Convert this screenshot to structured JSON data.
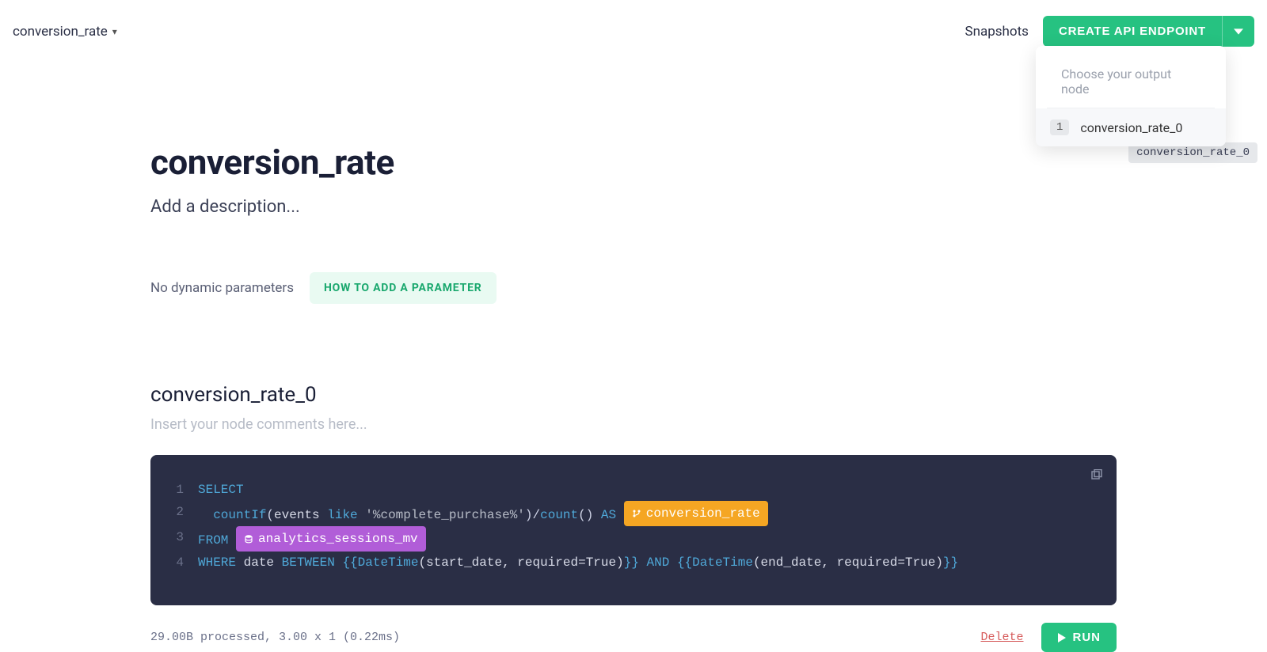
{
  "header": {
    "breadcrumb": "conversion_rate",
    "snapshots_label": "Snapshots",
    "create_button": "CREATE API ENDPOINT"
  },
  "dropdown": {
    "label": "Choose your output node",
    "item_number": "1",
    "item_label": "conversion_rate_0"
  },
  "tooltip": "conversion_rate_0",
  "page": {
    "title": "conversion_rate",
    "description_placeholder": "Add a description...",
    "no_params": "No dynamic parameters",
    "how_to_add": "HOW TO ADD A PARAMETER"
  },
  "node": {
    "title": "conversion_rate_0",
    "comments_placeholder": "Insert your node comments here..."
  },
  "code": {
    "l1": {
      "num": "1",
      "kw": "SELECT"
    },
    "l2": {
      "num": "2",
      "indent": "  ",
      "fn1": "countIf",
      "open": "(",
      "arg1": "events ",
      "like": "like",
      "str": " '%complete_purchase%'",
      "close": ")",
      "slash": "/",
      "fn2": "count",
      "parens2": "()",
      "as": " AS ",
      "pill": "conversion_rate"
    },
    "l3": {
      "num": "3",
      "kw": "FROM",
      "sp": " ",
      "pill": "analytics_sessions_mv"
    },
    "l4": {
      "num": "4",
      "kw1": "WHERE",
      "sp1": " date ",
      "kw2": "BETWEEN",
      "sp2": " ",
      "bo1": "{{",
      "dt1": "DateTime",
      "args1": "(start_date, required=True)",
      "bc1": "}}",
      "and": " AND ",
      "bo2": "{{",
      "dt2": "DateTime",
      "args2": "(end_date, required=True)",
      "bc2": "}}"
    }
  },
  "footer": {
    "stats": "29.00B processed, 3.00 x 1 (0.22ms)",
    "delete": "Delete",
    "run": "RUN"
  }
}
